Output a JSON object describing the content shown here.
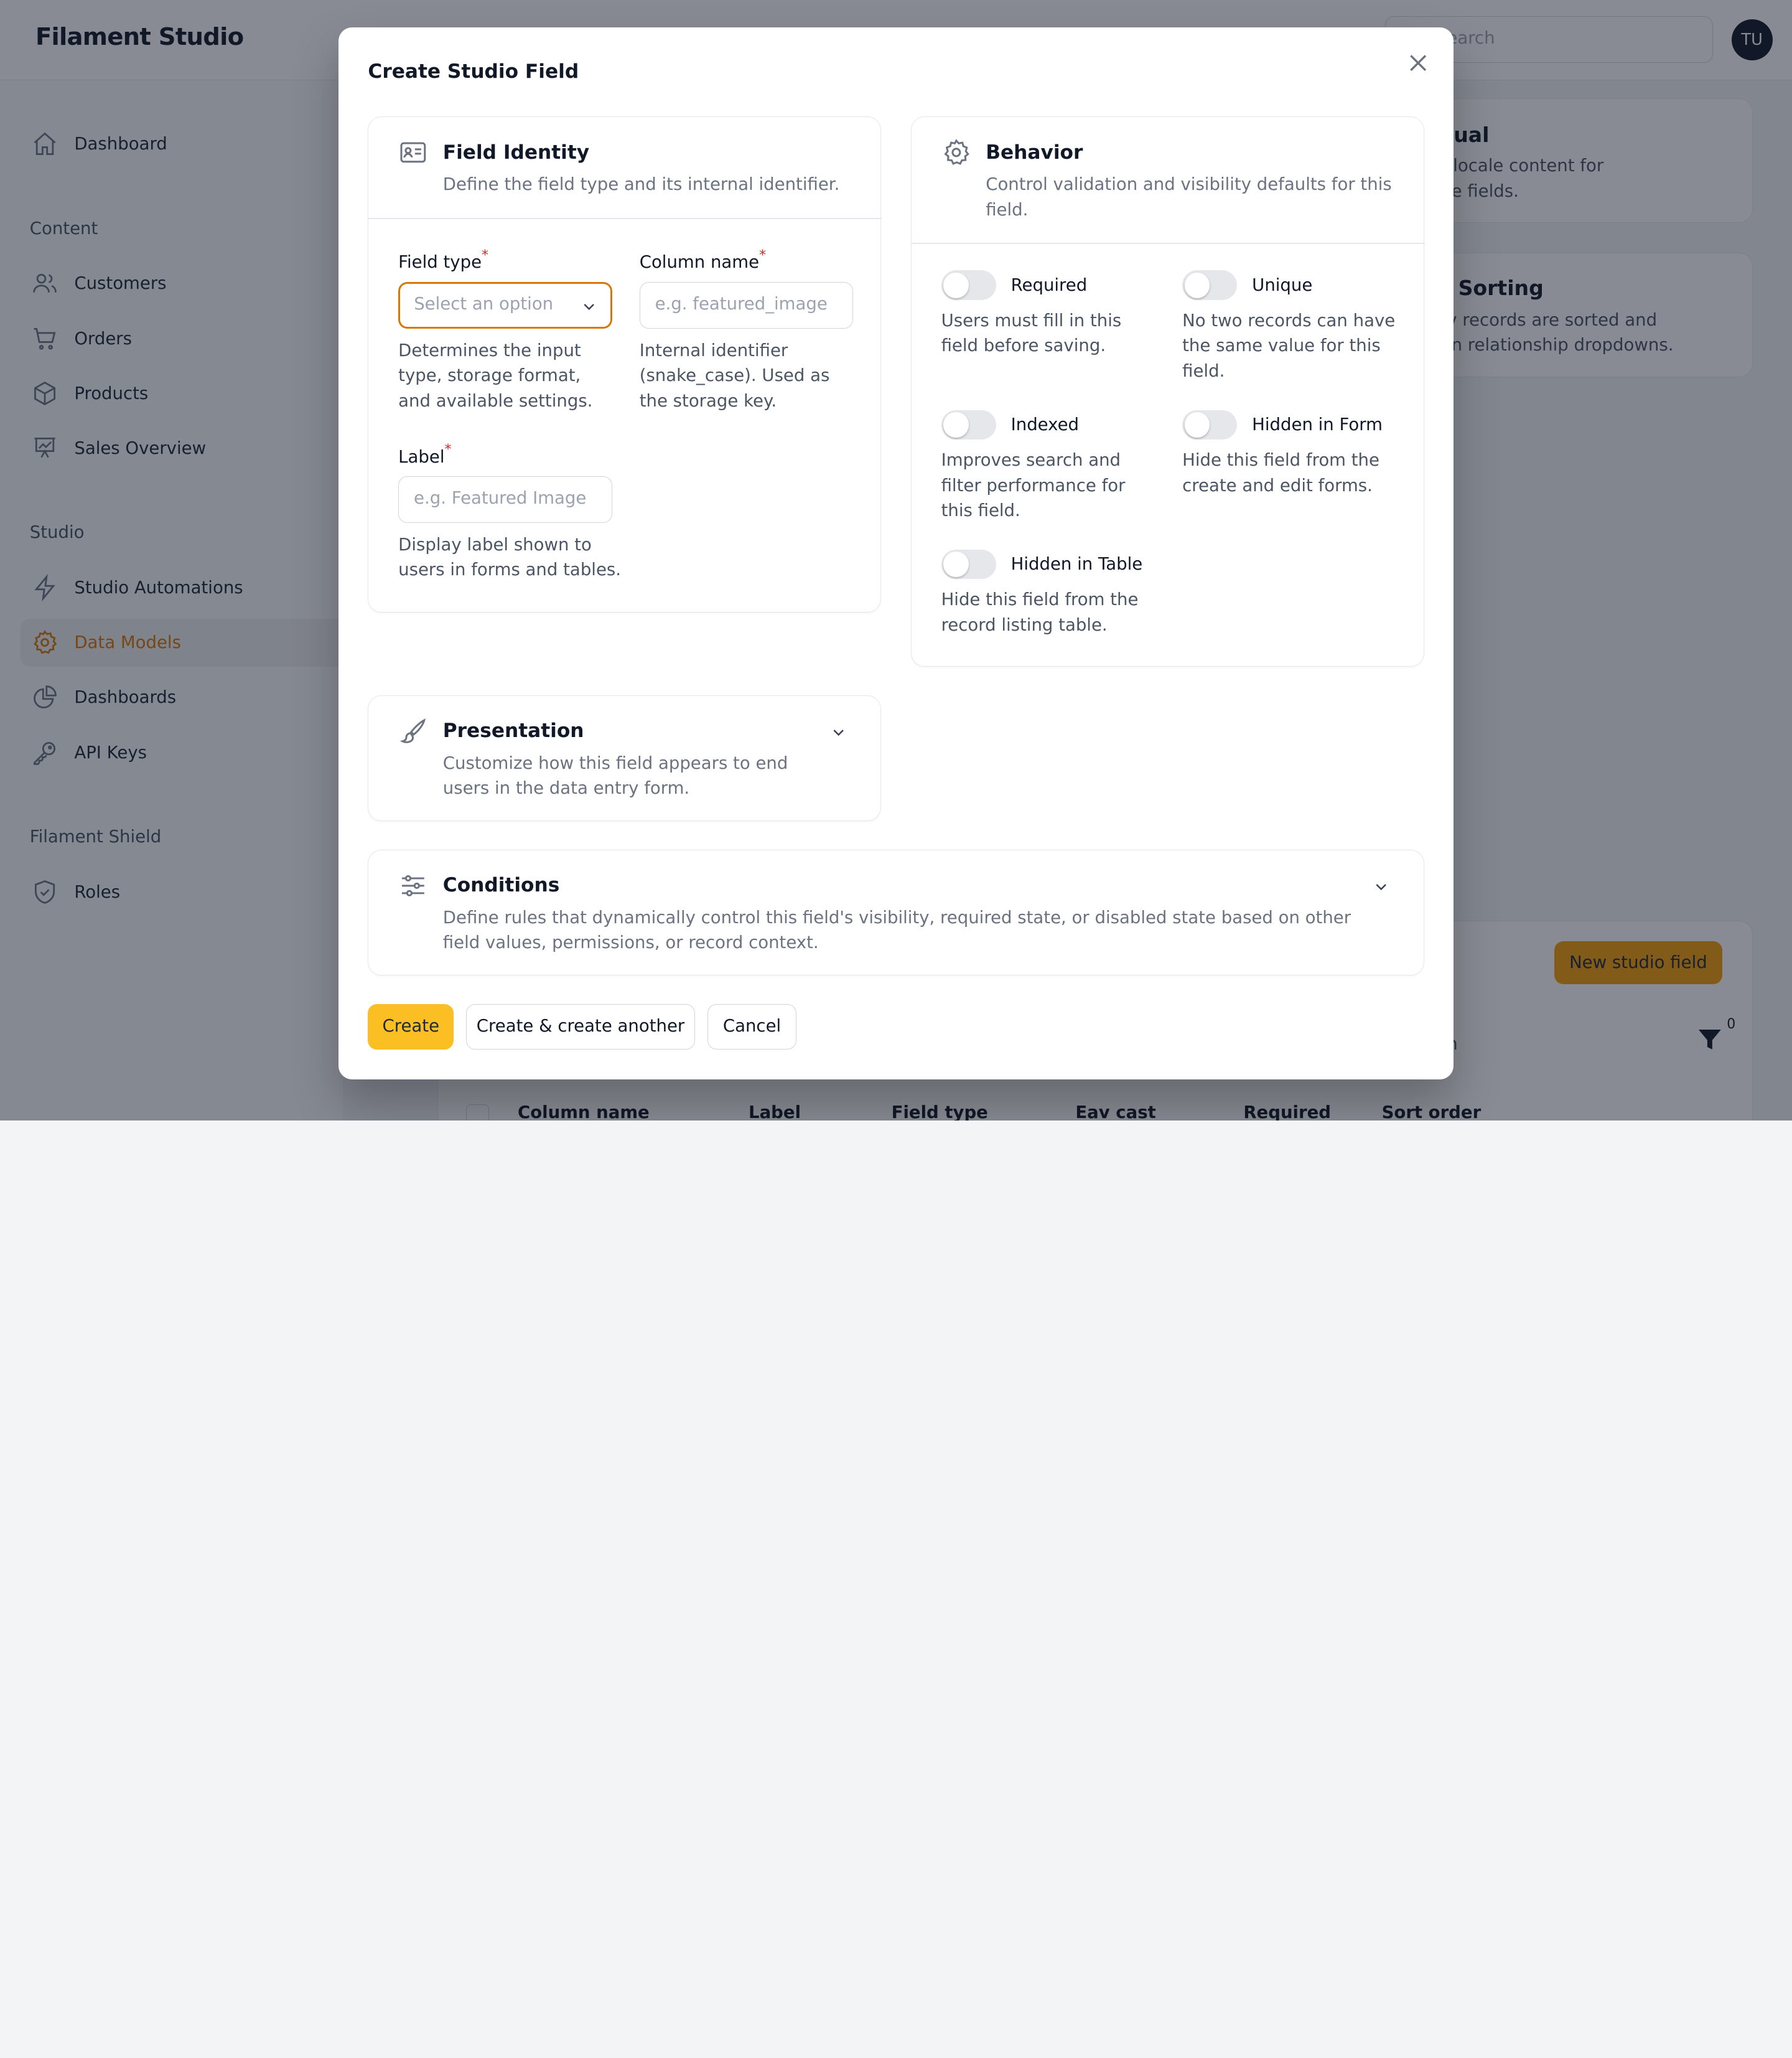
{
  "app": {
    "brand": "Filament Studio",
    "search_placeholder": "Search",
    "avatar_initials": "TU"
  },
  "sidebar": {
    "items_top": [
      {
        "label": "Dashboard",
        "icon": "home-icon"
      }
    ],
    "group_content": "Content",
    "content_items": [
      {
        "label": "Customers",
        "icon": "users-icon"
      },
      {
        "label": "Orders",
        "icon": "cart-icon"
      },
      {
        "label": "Products",
        "icon": "cube-icon"
      },
      {
        "label": "Sales Overview",
        "icon": "chart-icon"
      }
    ],
    "group_studio": "Studio",
    "studio_items": [
      {
        "label": "Studio Automations",
        "icon": "bolt-icon"
      },
      {
        "label": "Data Models",
        "icon": "gear-icon",
        "active": true
      },
      {
        "label": "Dashboards",
        "icon": "pie-chart-icon"
      },
      {
        "label": "API Keys",
        "icon": "key-icon"
      }
    ],
    "group_shield": "Filament Shield",
    "shield_items": [
      {
        "label": "Roles",
        "icon": "shield-icon"
      }
    ]
  },
  "background": {
    "card1_title": "ual",
    "card1_text_1": "-locale content for",
    "card1_text_2": "e fields.",
    "card2_title": "Sorting",
    "card2_text_1": "v records are sorted and",
    "card2_text_2": "n relationship dropdowns.",
    "new_field_button": "New studio field",
    "table_search_placeholder": "h",
    "filter_count": "0",
    "columns": [
      "Column name",
      "Label",
      "Field type",
      "Eav cast",
      "Required",
      "Sort order"
    ]
  },
  "modal": {
    "title": "Create Studio Field",
    "identity": {
      "title": "Field Identity",
      "description": "Define the field type and its internal identifier.",
      "field_type_label": "Field type",
      "field_type_placeholder": "Select an option",
      "field_type_help": "Determines the input type, storage format, and available settings.",
      "column_name_label": "Column name",
      "column_name_placeholder": "e.g. featured_image",
      "column_name_help": "Internal identifier (snake_case). Used as the storage key.",
      "label_label": "Label",
      "label_placeholder": "e.g. Featured Image",
      "label_help": "Display label shown to users in forms and tables."
    },
    "behavior": {
      "title": "Behavior",
      "description": "Control validation and visibility defaults for this field.",
      "toggles": [
        {
          "label": "Required",
          "help": "Users must fill in this field before saving.",
          "on": false
        },
        {
          "label": "Unique",
          "help": "No two records can have the same value for this field.",
          "on": false
        },
        {
          "label": "Indexed",
          "help": "Improves search and filter performance for this field.",
          "on": false
        },
        {
          "label": "Hidden in Form",
          "help": "Hide this field from the create and edit forms.",
          "on": false
        },
        {
          "label": "Hidden in Table",
          "help": "Hide this field from the record listing table.",
          "on": false
        }
      ]
    },
    "presentation": {
      "title": "Presentation",
      "description": "Customize how this field appears to end users in the data entry form."
    },
    "conditions": {
      "title": "Conditions",
      "description": "Define rules that dynamically control this field's visibility, required state, or disabled state based on other field values, permissions, or record context."
    },
    "buttons": {
      "create": "Create",
      "create_another": "Create & create another",
      "cancel": "Cancel"
    }
  },
  "colors": {
    "accent": "#d97706",
    "primary_button": "#fbbf24",
    "overlay": "rgba(17,24,39,0.5)"
  }
}
